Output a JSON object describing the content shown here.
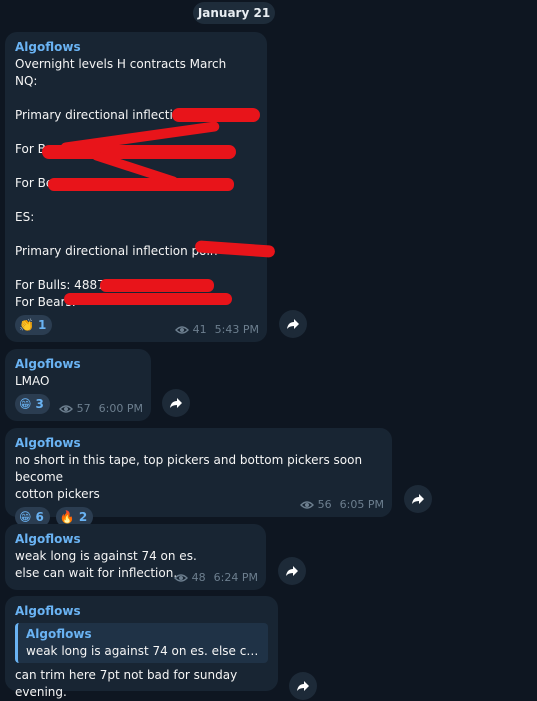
{
  "date_label": "January 21",
  "share_icon": "share-arrow-icon",
  "views_icon": "eye-icon",
  "messages": [
    {
      "sender": "Algoflows",
      "lines": [
        "Overnight levels H contracts March",
        "NQ:",
        "",
        "Primary directional inflection p",
        "",
        "For Bu",
        "",
        "For Be",
        "",
        "ES:",
        "",
        "Primary directional inflection poin",
        "",
        "For Bulls: 4887.",
        "For Bears:"
      ],
      "reactions": [
        {
          "emoji": "👏",
          "count": "1"
        }
      ],
      "views": "41",
      "time": "5:43 PM"
    },
    {
      "sender": "Algoflows",
      "lines": [
        "LMAO"
      ],
      "reactions": [
        {
          "emoji": "😁",
          "count": "3"
        }
      ],
      "views": "57",
      "time": "6:00 PM"
    },
    {
      "sender": "Algoflows",
      "lines": [
        "no short in this tape, top pickers and bottom pickers soon become",
        "cotton pickers"
      ],
      "reactions": [
        {
          "emoji": "😁",
          "count": "6"
        },
        {
          "emoji": "🔥",
          "count": "2"
        }
      ],
      "views": "56",
      "time": "6:05 PM"
    },
    {
      "sender": "Algoflows",
      "lines": [
        "weak long is against 74 on es.",
        "else can wait for inflection."
      ],
      "views": "48",
      "time": "6:24 PM"
    },
    {
      "sender": "Algoflows",
      "quote": {
        "sender": "Algoflows",
        "text": "weak long is against 74 on es. else can w..."
      },
      "lines": [
        "can trim here 7pt not bad for sunday evening."
      ]
    }
  ]
}
